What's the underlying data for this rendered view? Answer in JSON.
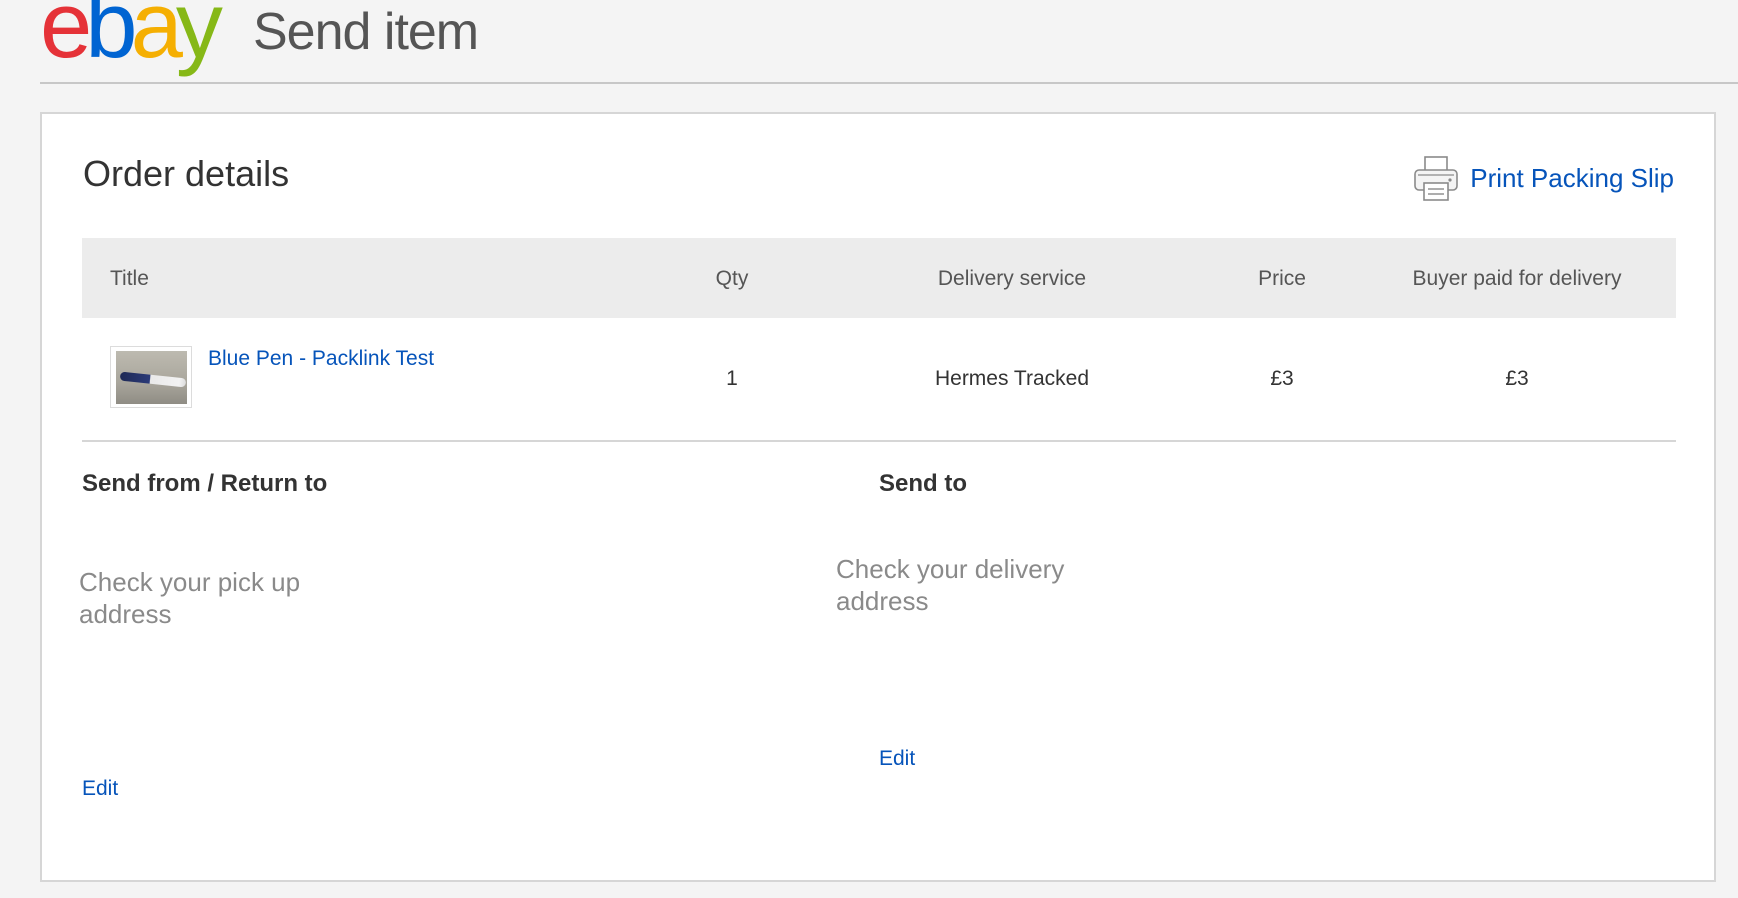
{
  "header": {
    "logo": {
      "e": "e",
      "b": "b",
      "a": "a",
      "y": "y"
    },
    "title": "Send item"
  },
  "card": {
    "title": "Order details",
    "print_link": {
      "icon": "printer-icon",
      "label": "Print Packing Slip"
    }
  },
  "table": {
    "columns": [
      "Title",
      "Qty",
      "Delivery service",
      "Price",
      "Buyer paid for delivery"
    ],
    "rows": [
      {
        "title": "Blue Pen - Packlink Test",
        "qty": "1",
        "delivery_service": "Hermes Tracked",
        "price": "£3",
        "buyer_paid": "£3"
      }
    ]
  },
  "send_from": {
    "title": "Send from / Return to",
    "placeholder": "Check your pick up address",
    "edit_label": "Edit"
  },
  "send_to": {
    "title": "Send to",
    "placeholder": "Check your delivery address",
    "edit_label": "Edit"
  },
  "colors": {
    "link": "#0654ba",
    "logo_e": "#e53238",
    "logo_b": "#0064d2",
    "logo_a": "#f5af02",
    "logo_y": "#86b817"
  }
}
